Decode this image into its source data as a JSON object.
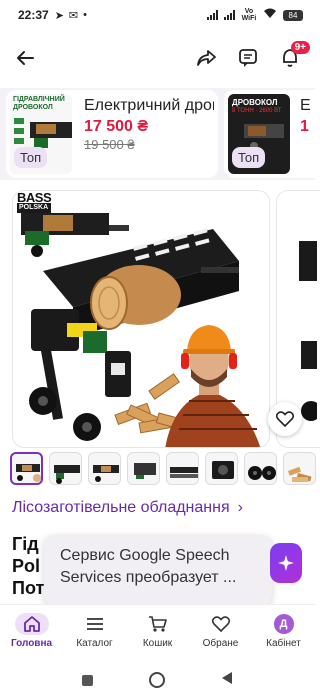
{
  "status_bar": {
    "time": "22:37",
    "battery": "84",
    "wifi_label": "Vo WiFi"
  },
  "top_bar": {
    "notification_count": "9+"
  },
  "promo": {
    "cards": [
      {
        "thumb_label": "ГІДРАВЛІЧНИЙ ДРОВОКОЛ",
        "title": "Електричний дровокол гідр...",
        "price": "17 500 ₴",
        "old_price": "19 500 ₴",
        "tag": "Топ"
      },
      {
        "thumb_label": "ДРОВОКОЛ",
        "thumb_sub": "8 ТОНН · 2600 ВТ",
        "title": "Е",
        "price": "1",
        "tag": "Топ"
      }
    ]
  },
  "gallery": {
    "brand_logo": "BASS",
    "brand_sub": "POLSKA"
  },
  "category": {
    "label": "Лісозаготівельне обладнання"
  },
  "product": {
    "title_lines": [
      "Гід",
      "Pol",
      "Пот"
    ]
  },
  "toast": {
    "text": "Сервис Google Speech Services преобразует ..."
  },
  "bottom_nav": {
    "items": [
      {
        "label": "Головна",
        "icon": "home-icon"
      },
      {
        "label": "Каталог",
        "icon": "menu-icon"
      },
      {
        "label": "Кошик",
        "icon": "cart-icon"
      },
      {
        "label": "Обране",
        "icon": "heart-icon"
      },
      {
        "label": "Кабінет",
        "icon": "avatar-icon",
        "avatar_letter": "Д"
      }
    ]
  },
  "colors": {
    "accent": "#6a2aa8",
    "price": "#e01a3c",
    "badge": "#e8214a"
  }
}
